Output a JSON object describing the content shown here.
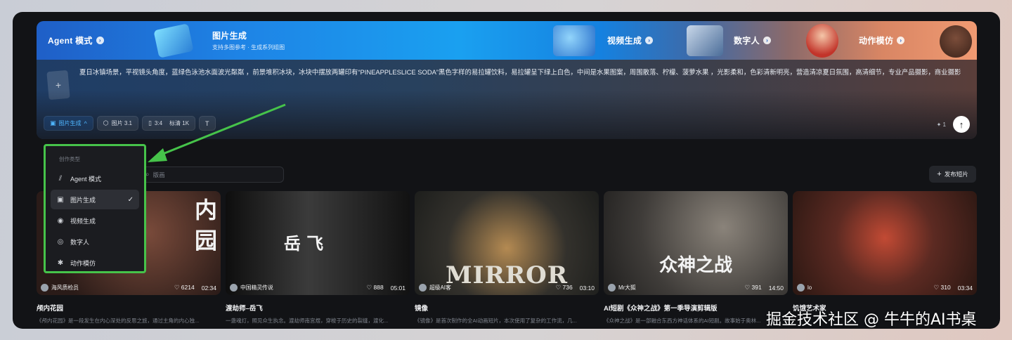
{
  "banner": {
    "agent": {
      "label": "Agent 模式"
    },
    "image_gen": {
      "title": "图片生成",
      "subtitle": "支持多图参考 · 生成系列组图"
    },
    "video_gen": {
      "label": "视频生成"
    },
    "digital_human": {
      "label": "数字人"
    },
    "motion": {
      "label": "动作模仿"
    },
    "arrow_glyph": "›"
  },
  "prompt": {
    "ref_plus": "+",
    "text": "夏日冰镇场景，平视镜头角度，蓝绿色泳池水面波光粼粼 ，前景堆积冰块，冰块中摆放两罐印有“PINEAPPLESLICE SODA”黑色字样的易拉罐饮料，易拉罐呈下绿上白色，中间是水果图案，周围散落、柠檬、菠萝水果 ，光影柔和，色彩清新明亮，营造清凉夏日氛围，高清细节，专业产品摄影，商业摄影"
  },
  "toolbar": {
    "mode": "图片生成",
    "mode_caret": "^",
    "model": "图片 3.1",
    "ratio": "3:4",
    "quality": "标清 1K",
    "text_icon": "T"
  },
  "send": {
    "credit": "✦ 1",
    "arrow": "↑"
  },
  "search": {
    "placeholder": "版画"
  },
  "publish": {
    "label": "发布短片",
    "plus": "+"
  },
  "dropdown": {
    "header": "创作类型",
    "items": [
      {
        "label": "Agent 模式",
        "icon": "agent-icon",
        "glyph": "⫽"
      },
      {
        "label": "图片生成",
        "icon": "image-icon",
        "glyph": "▣",
        "selected": true
      },
      {
        "label": "视频生成",
        "icon": "video-icon",
        "glyph": "◉"
      },
      {
        "label": "数字人",
        "icon": "digital-human-icon",
        "glyph": "◎"
      },
      {
        "label": "动作模仿",
        "icon": "motion-icon",
        "glyph": "✱"
      }
    ],
    "check": "✓"
  },
  "cards": [
    {
      "author": "海风质检员",
      "likes": "♡ 6214",
      "duration": "02:34",
      "title": "颅内花园",
      "desc": "《颅内花园》是一段发生在内心深处的反思之旅，通过主角的内心独...",
      "overlay": "内 园",
      "bg": "#3a2a28"
    },
    {
      "author": "中国精灵传说",
      "likes": "♡ 888",
      "duration": "05:01",
      "title": "渡劫师–岳飞",
      "desc": "一盏魂灯，照见众生执念。渡劫师南宫煜，穿梭于历史的裂缝，渡化...",
      "overlay": "岳 飞",
      "bg": "#222222"
    },
    {
      "author": "超级AI客",
      "likes": "♡ 736",
      "duration": "03:10",
      "title": "镜像",
      "desc": "《镜像》是首次制作的全AI动画短片，本次使用了复杂的工作流，几...",
      "overlay": "MIRROR",
      "bg": "#3b3f3c"
    },
    {
      "author": "Mr大狐",
      "likes": "♡ 391",
      "duration": "14:50",
      "title": "AI短剧《众神之战》第一季导演剪辑版",
      "desc": "《众神之战》是一部融合东西方神话体系的AI短剧。故事始于奥林...",
      "overlay": "众神之战",
      "bg": "#5a5652"
    },
    {
      "author": "lo",
      "likes": "♡ 310",
      "duration": "03:34",
      "title": "饥饿艺术家",
      "desc": "",
      "overlay": "",
      "bg": "#5c2a22"
    }
  ],
  "watermark": "掘金技术社区 @ 牛牛的AI书桌"
}
